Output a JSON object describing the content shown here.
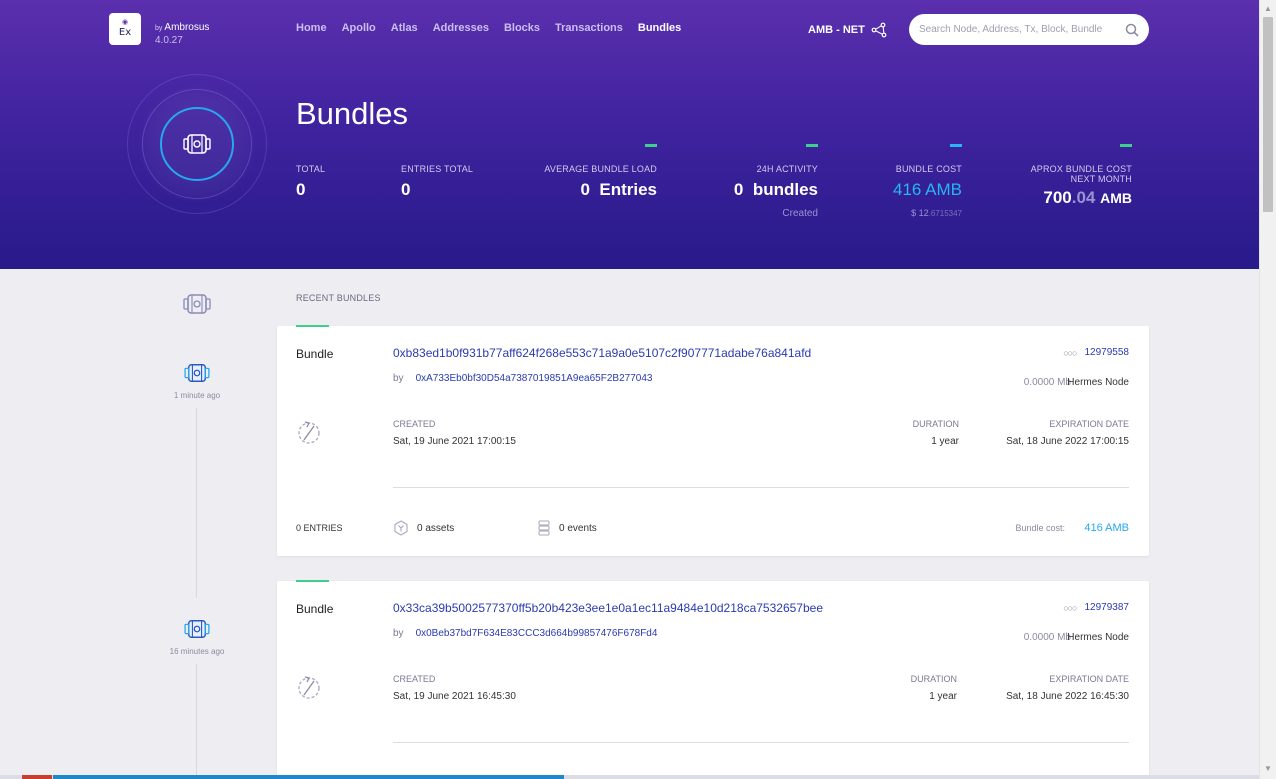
{
  "header": {
    "logo_text": "Ex",
    "brand_prefix": "by",
    "brand": "Ambrosus",
    "version": "4.0.27",
    "nav": [
      "Home",
      "Apollo",
      "Atlas",
      "Addresses",
      "Blocks",
      "Transactions",
      "Bundles"
    ],
    "active_nav": "Bundles",
    "network": "AMB - NET",
    "search_placeholder": "Search Node, Address, Tx, Block, Bundle"
  },
  "hero": {
    "title": "Bundles",
    "stats": {
      "total_label": "TOTAL",
      "total_value": "0",
      "entries_label": "ENTRIES TOTAL",
      "entries_value": "0",
      "avg_label": "AVERAGE BUNDLE LOAD",
      "avg_value": "0  Entries",
      "activity_label": "24H ACTIVITY",
      "activity_value": "0  bundles",
      "activity_sub": "Created",
      "cost_label": "BUNDLE COST",
      "cost_value": "416 AMB",
      "cost_sub_main": "$ 12",
      "cost_sub_dec": ".6715347",
      "aprox_label": "APROX BUNDLE COST NEXT MONTH",
      "aprox_int": "700",
      "aprox_dec": ".04",
      "aprox_unit": "AMB"
    }
  },
  "main": {
    "section_label": "RECENT BUNDLES",
    "timeline": [
      "1 minute ago",
      "16 minutes ago"
    ],
    "bundles": [
      {
        "kind": "Bundle",
        "hash": "0xb83ed1b0f931b77aff624f268e553c71a9a0e5107c2f907771adabe76a841afd",
        "by_label": "by",
        "by": "0xA733Eb0bf30D54a7387019851A9ea65F2B277043",
        "block": "12979558",
        "size": "0.0000 Mb",
        "node": "Hermes Node",
        "created_label": "CREATED",
        "created": "Sat, 19 June 2021 17:00:15",
        "duration_label": "DURATION",
        "duration": "1 year",
        "expiration_label": "EXPIRATION DATE",
        "expiration": "Sat, 18 June 2022 17:00:15",
        "entries": "0 ENTRIES",
        "assets": "0 assets",
        "events": "0 events",
        "cost_label": "Bundle cost:",
        "cost": "416 AMB"
      },
      {
        "kind": "Bundle",
        "hash": "0x33ca39b5002577370ff5b20b423e3ee1e0a1ec11a9484e10d218ca7532657bee",
        "by_label": "by",
        "by": "0x0Beb37bd7F634E83CCC3d664b99857476F678Fd4",
        "block": "12979387",
        "size": "0.0000 Mb",
        "node": "Hermes Node",
        "created_label": "CREATED",
        "created": "Sat, 19 June 2021 16:45:30",
        "duration_label": "DURATION",
        "duration": "1 year",
        "expiration_label": "EXPIRATION DATE",
        "expiration": "Sat, 18 June 2022 16:45:30"
      }
    ]
  },
  "colors": {
    "accent_green": "#3ecf8e",
    "accent_cyan": "#27b6f0",
    "link_blue": "#2a3bb0",
    "header_purple": "#5b2fae"
  },
  "icons": [
    "eye-icon",
    "network-icon",
    "search-icon",
    "bundle-icon",
    "sync-icon",
    "asset-icon",
    "event-icon",
    "chain-icon"
  ]
}
